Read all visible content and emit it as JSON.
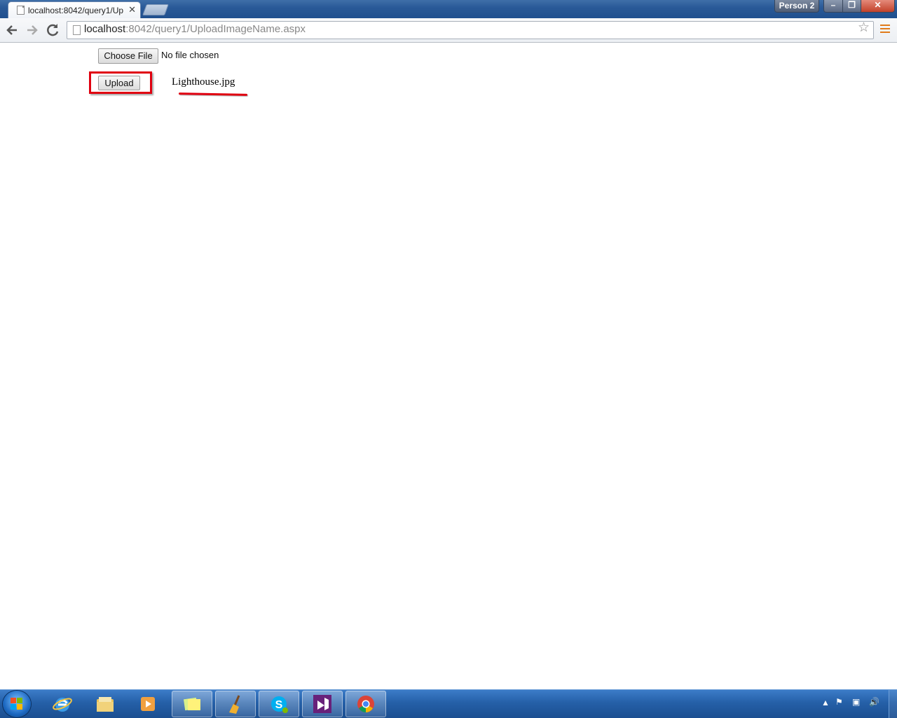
{
  "tabs": [
    {
      "title": "localhost:8042/query1/Up"
    }
  ],
  "window": {
    "profile_label": "Person 2",
    "minimize": "–",
    "restore": "❐",
    "close": "✕"
  },
  "toolbar": {
    "back_icon": "back-arrow-icon",
    "forward_icon": "forward-arrow-icon",
    "reload_icon": "reload-icon",
    "url_host": "localhost",
    "url_rest": ":8042/query1/UploadImageName.aspx"
  },
  "page": {
    "choose_file_label": "Choose File",
    "no_file_text": "No file chosen",
    "upload_label": "Upload",
    "uploaded_filename": "Lighthouse.jpg",
    "highlight_color": "#e00010"
  },
  "taskbar": {
    "apps": [
      "internet-explorer",
      "windows-explorer",
      "media-player",
      "sticky-notes",
      "ccleaner",
      "skype",
      "visual-studio",
      "chrome"
    ],
    "active_app": "chrome"
  }
}
